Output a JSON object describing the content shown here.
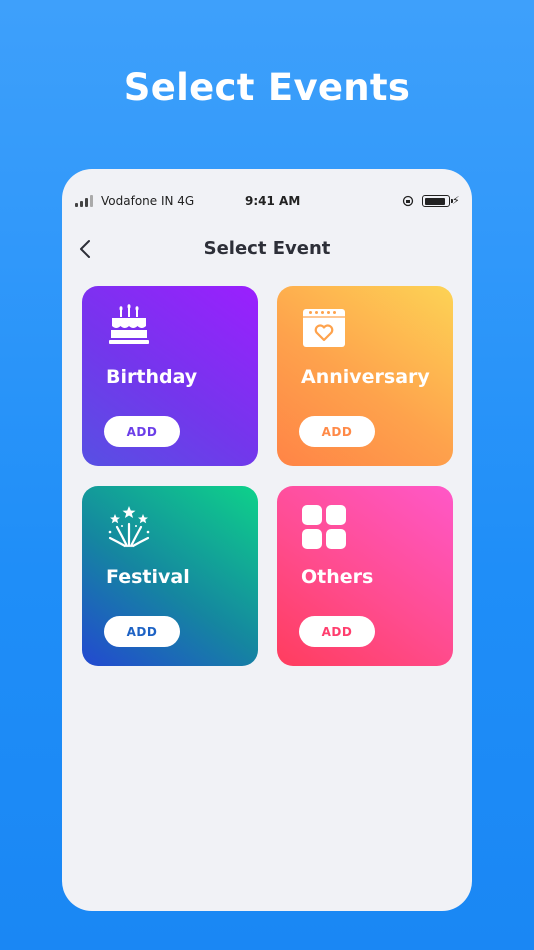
{
  "promo": {
    "title": "Select Events"
  },
  "status_bar": {
    "carrier": "Vodafone IN 4G",
    "time": "9:41 AM"
  },
  "nav": {
    "title": "Select Event",
    "back_icon": "chevron-left-icon"
  },
  "events": [
    {
      "label": "Birthday",
      "button": "ADD",
      "icon": "cake-icon",
      "accent": "#6b3ee8"
    },
    {
      "label": "Anniversary",
      "button": "ADD",
      "icon": "calendar-heart-icon",
      "accent": "#ff8a48"
    },
    {
      "label": "Festival",
      "button": "ADD",
      "icon": "fireworks-icon",
      "accent": "#1d62c4"
    },
    {
      "label": "Others",
      "button": "ADD",
      "icon": "grid-icon",
      "accent": "#ff3e6e"
    }
  ],
  "colors": {
    "background": "#2193f9",
    "phone_bg": "#f1f2f6",
    "title_text": "#2d2f38"
  }
}
